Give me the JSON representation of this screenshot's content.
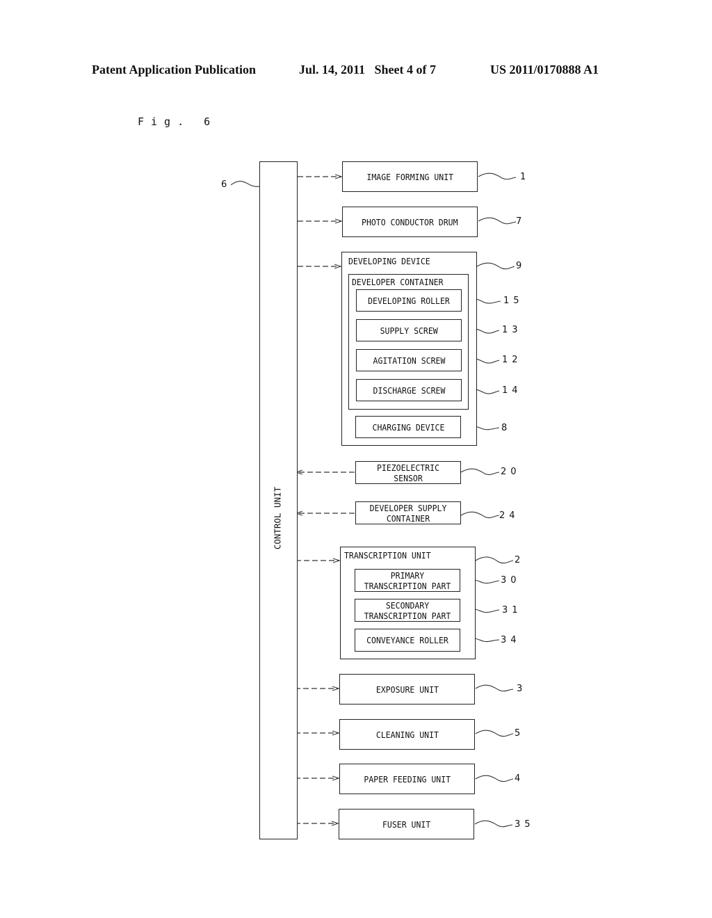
{
  "header": {
    "publication": "Patent Application Publication",
    "date_sheet": "Jul. 14, 2011   Sheet 4 of 7",
    "number": "US 2011/0170888 A1"
  },
  "figure": {
    "label": "Fig. 6"
  },
  "control_unit": {
    "label": "CONTROL UNIT",
    "ref": "6"
  },
  "blocks": {
    "image_forming_unit": {
      "label": "IMAGE FORMING UNIT",
      "ref": "1",
      "direction": "output"
    },
    "photo_conductor_drum": {
      "label": "PHOTO CONDUCTOR DRUM",
      "ref": "7",
      "direction": "output"
    },
    "developing_device": {
      "label": "DEVELOPING DEVICE",
      "ref": "9",
      "direction": "output",
      "developer_container": {
        "label": "DEVELOPER CONTAINER",
        "items": [
          {
            "label": "DEVELOPING ROLLER",
            "ref": "15"
          },
          {
            "label": "SUPPLY SCREW",
            "ref": "13"
          },
          {
            "label": "AGITATION SCREW",
            "ref": "12"
          },
          {
            "label": "DISCHARGE SCREW",
            "ref": "14"
          }
        ]
      },
      "charging_device": {
        "label": "CHARGING DEVICE",
        "ref": "8"
      }
    },
    "piezoelectric_sensor": {
      "label_line1": "PIEZOELECTRIC",
      "label_line2": "SENSOR",
      "ref": "20",
      "direction": "input"
    },
    "developer_supply_container": {
      "label_line1": "DEVELOPER SUPPLY",
      "label_line2": "CONTAINER",
      "ref": "24",
      "direction": "input"
    },
    "transcription_unit": {
      "label": "TRANSCRIPTION UNIT",
      "ref": "2",
      "direction": "output",
      "items": [
        {
          "label_line1": "PRIMARY",
          "label_line2": "TRANSCRIPTION PART",
          "ref": "30"
        },
        {
          "label_line1": "SECONDARY",
          "label_line2": "TRANSCRIPTION PART",
          "ref": "31"
        },
        {
          "label_line1": "CONVEYANCE ROLLER",
          "label_line2": "",
          "ref": "34"
        }
      ]
    },
    "exposure_unit": {
      "label": "EXPOSURE UNIT",
      "ref": "3",
      "direction": "output"
    },
    "cleaning_unit": {
      "label": "CLEANING UNIT",
      "ref": "5",
      "direction": "output"
    },
    "paper_feeding_unit": {
      "label": "PAPER FEEDING UNIT",
      "ref": "4",
      "direction": "output"
    },
    "fuser_unit": {
      "label": "FUSER UNIT",
      "ref": "35",
      "direction": "output"
    }
  }
}
